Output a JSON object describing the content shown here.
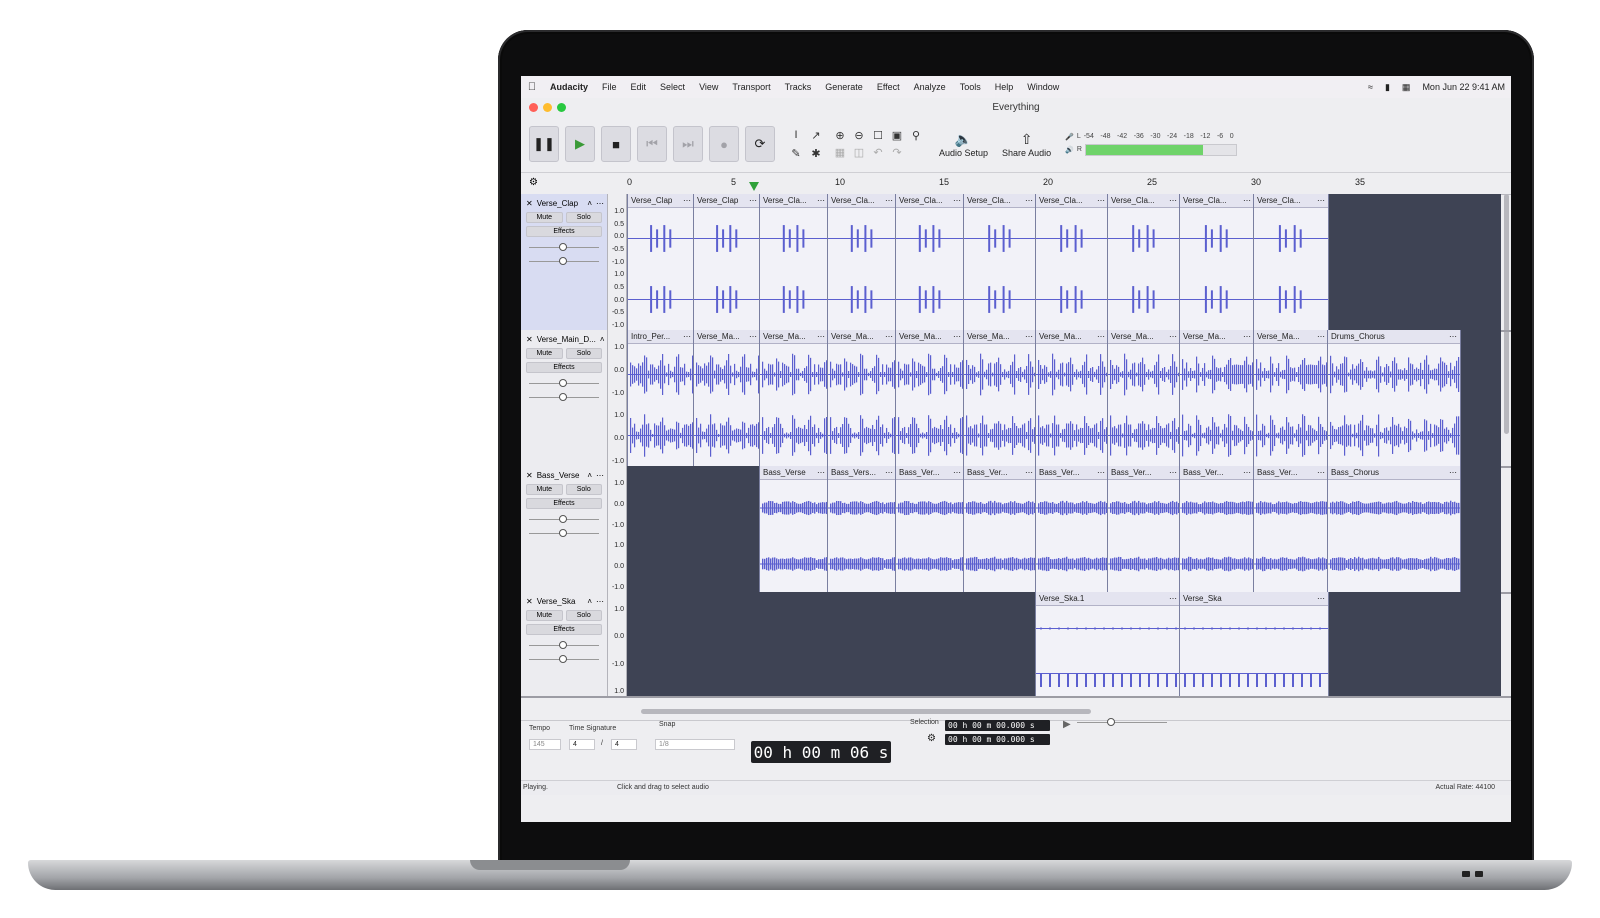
{
  "mac_menubar": {
    "app": "Audacity",
    "items": [
      "File",
      "Edit",
      "Select",
      "View",
      "Transport",
      "Tracks",
      "Generate",
      "Effect",
      "Analyze",
      "Tools",
      "Help",
      "Window"
    ],
    "clock": "Mon Jun 22  9:41 AM"
  },
  "window": {
    "title": "Everything",
    "traffic_colors": [
      "#ff5f57",
      "#febc2e",
      "#28c840"
    ]
  },
  "toolbar": {
    "audio_setup_label": "Audio Setup",
    "share_audio_label": "Share Audio",
    "meter_scale": [
      "-54",
      "-48",
      "-42",
      "-36",
      "-30",
      "-24",
      "-18",
      "-12",
      "-6",
      "0"
    ],
    "meter_channels": [
      "L",
      "R"
    ],
    "playback_level_fraction": 0.78,
    "playback_meter_color": "#6fd36a"
  },
  "ruler": {
    "ticks": [
      "0",
      "5",
      "10",
      "15",
      "20",
      "25",
      "30",
      "35"
    ]
  },
  "colors": {
    "waveform": "#5b5fcf",
    "empty_lane": "#3e4354",
    "clip_bg": "#f2f2f8"
  },
  "tracks": [
    {
      "name": "Verse_Clap",
      "mute": "Mute",
      "solo": "Solo",
      "effects": "Effects",
      "selected": true,
      "scale": [
        "1.0",
        "0.5",
        "0.0",
        "-0.5",
        "-1.0",
        "1.0",
        "0.5",
        "0.0",
        "-0.5",
        "-1.0"
      ],
      "clips": [
        "Verse_Clap",
        "Verse_Clap",
        "Verse_Cla...",
        "Verse_Cla...",
        "Verse_Cla...",
        "Verse_Cla...",
        "Verse_Cla...",
        "Verse_Cla...",
        "Verse_Cla...",
        "Verse_Cla..."
      ]
    },
    {
      "name": "Verse_Main_D...",
      "mute": "Mute",
      "solo": "Solo",
      "effects": "Effects",
      "selected": false,
      "scale": [
        "1.0",
        "0.0",
        "-1.0",
        "1.0",
        "0.0",
        "-1.0"
      ],
      "clips": [
        "Intro_Per...",
        "Verse_Ma...",
        "Verse_Ma...",
        "Verse_Ma...",
        "Verse_Ma...",
        "Verse_Ma...",
        "Verse_Ma...",
        "Verse_Ma...",
        "Verse_Ma...",
        "Verse_Ma...",
        "Drums_Chorus"
      ]
    },
    {
      "name": "Bass_Verse",
      "mute": "Mute",
      "solo": "Solo",
      "effects": "Effects",
      "selected": false,
      "scale": [
        "1.0",
        "0.0",
        "-1.0",
        "1.0",
        "0.0",
        "-1.0"
      ],
      "clips": [
        "Bass_Verse",
        "Bass_Vers...",
        "Bass_Ver...",
        "Bass_Ver...",
        "Bass_Ver...",
        "Bass_Ver...",
        "Bass_Ver...",
        "Bass_Ver...",
        "Bass_Chorus"
      ]
    },
    {
      "name": "Verse_Ska",
      "mute": "Mute",
      "solo": "Solo",
      "effects": "Effects",
      "selected": false,
      "scale": [
        "1.0",
        "0.0",
        "-1.0",
        "1.0"
      ],
      "clips": [
        "Verse_Ska.1",
        "Verse_Ska"
      ]
    }
  ],
  "bottom": {
    "tempo_label": "Tempo",
    "tempo_value": "145",
    "time_signature_label": "Time Signature",
    "ts_numerator": "4",
    "ts_slash": "/",
    "ts_denominator": "4",
    "snap_label": "Snap",
    "snap_value": "1/8",
    "time_display": "00 h 00 m 06 s",
    "selection_label": "Selection",
    "selection_start": "00 h 00 m 00.000 s",
    "selection_end": "00 h 00 m 00.000 s"
  },
  "status": {
    "state": "Playing.",
    "hint": "Click and drag to select audio",
    "rate": "Actual Rate: 44100"
  }
}
